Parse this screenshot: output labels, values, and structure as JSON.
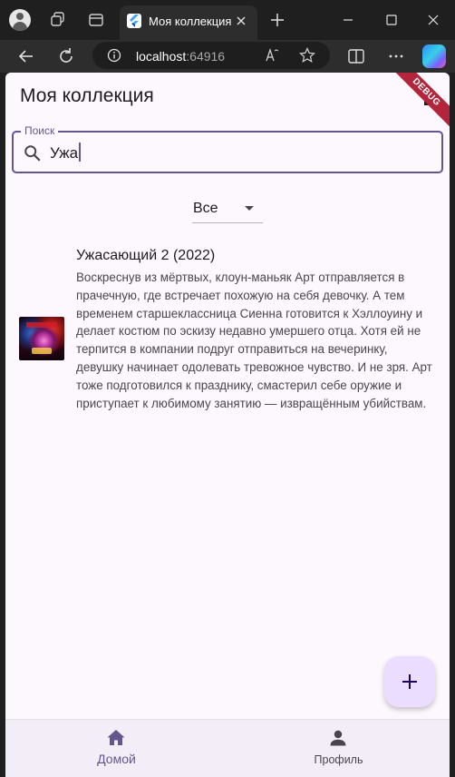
{
  "browser": {
    "tab_title": "Моя коллекция",
    "address_host": "localhost",
    "address_port": ":64916"
  },
  "app": {
    "title": "Моя коллекция",
    "debug_banner": "DEBUG",
    "search": {
      "label": "Поиск",
      "value": "Ужа"
    },
    "filter": {
      "selected": "Все"
    },
    "movies": [
      {
        "title": "Ужасающий 2 (2022)",
        "description": "Воскреснув из мёртвых, клоун-маньяк Арт отправляется в прачечную, где встречает похожую на себя девочку. А тем временем старшеклассница Сиенна готовится к Хэллоуину и делает костюм по эскизу недавно умершего отца. Хотя ей не терпится в компании подруг отправиться на вечеринку, девушку начинает одолевать тревожное чувство. И не зря. Арт тоже подготовился к празднику, смастерил себе оружие и приступает к любимому занятию — извращённым убийствам."
      }
    ],
    "nav": {
      "home_label": "Домой",
      "profile_label": "Профиль"
    }
  },
  "colors": {
    "accent": "#65558f",
    "surface": "#fdf7fe",
    "fab": "#eaddff",
    "navbar": "#f3edf7",
    "debug": "#b3253b"
  }
}
